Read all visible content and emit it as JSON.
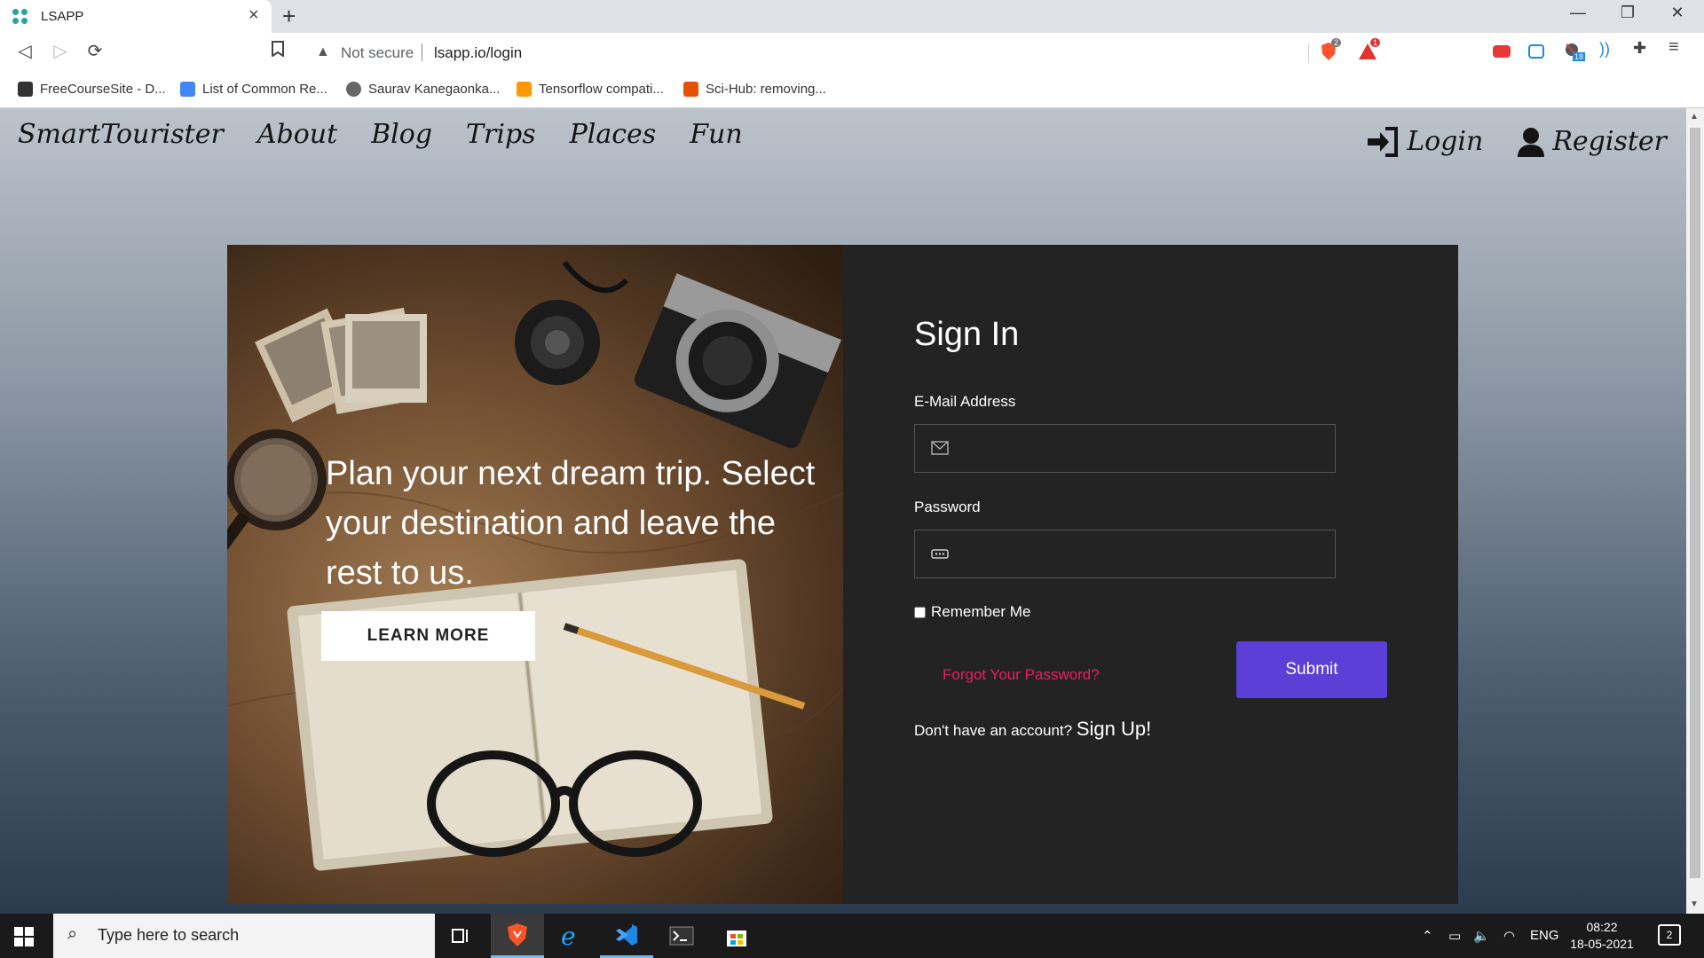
{
  "browser": {
    "tab_title": "LSAPP",
    "security_label": "Not secure",
    "url": "lsapp.io/login",
    "bookmarks": [
      {
        "label": "FreeCourseSite - D...",
        "icon": "freecoursesite-icon"
      },
      {
        "label": "List of Common Re...",
        "icon": "google-docs-icon"
      },
      {
        "label": "Saurav Kanegaonka...",
        "icon": "globe-icon"
      },
      {
        "label": "Tensorflow compati...",
        "icon": "tensorflow-icon"
      },
      {
        "label": "Sci-Hub: removing...",
        "icon": "scihub-icon"
      }
    ],
    "brave_shield_count": "2",
    "brave_rewards_count": "1",
    "extension_badge": "18"
  },
  "site": {
    "brand": "SmartTourister",
    "nav": [
      "About",
      "Blog",
      "Trips",
      "Places",
      "Fun"
    ],
    "auth": {
      "login": "Login",
      "register": "Register"
    }
  },
  "hero": {
    "text": "Plan your next dream trip. Select your destination and leave the rest to us.",
    "button": "LEARN MORE"
  },
  "signin": {
    "title": "Sign In",
    "email_label": "E-Mail Address",
    "email_value": "",
    "password_label": "Password",
    "password_value": "",
    "remember_label": "Remember Me",
    "remember_checked": false,
    "forgot_label": "Forgot Your Password?",
    "submit_label": "Submit",
    "no_account_text": "Don't have an account?",
    "signup_label": "Sign Up!"
  },
  "colors": {
    "submit": "#5b3fd6",
    "forgot": "#e91e63",
    "panel": "#232323"
  },
  "taskbar": {
    "search_placeholder": "Type here to search",
    "language": "ENG",
    "time": "08:22",
    "date": "18-05-2021",
    "notification_count": "2"
  }
}
